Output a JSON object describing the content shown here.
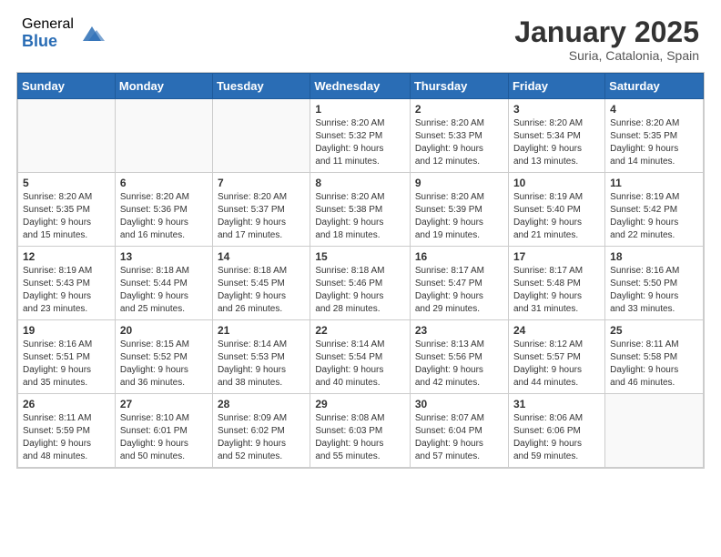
{
  "logo": {
    "general": "General",
    "blue": "Blue"
  },
  "title": "January 2025",
  "location": "Suria, Catalonia, Spain",
  "days_of_week": [
    "Sunday",
    "Monday",
    "Tuesday",
    "Wednesday",
    "Thursday",
    "Friday",
    "Saturday"
  ],
  "weeks": [
    [
      {
        "day": "",
        "info": ""
      },
      {
        "day": "",
        "info": ""
      },
      {
        "day": "",
        "info": ""
      },
      {
        "day": "1",
        "info": "Sunrise: 8:20 AM\nSunset: 5:32 PM\nDaylight: 9 hours\nand 11 minutes."
      },
      {
        "day": "2",
        "info": "Sunrise: 8:20 AM\nSunset: 5:33 PM\nDaylight: 9 hours\nand 12 minutes."
      },
      {
        "day": "3",
        "info": "Sunrise: 8:20 AM\nSunset: 5:34 PM\nDaylight: 9 hours\nand 13 minutes."
      },
      {
        "day": "4",
        "info": "Sunrise: 8:20 AM\nSunset: 5:35 PM\nDaylight: 9 hours\nand 14 minutes."
      }
    ],
    [
      {
        "day": "5",
        "info": "Sunrise: 8:20 AM\nSunset: 5:35 PM\nDaylight: 9 hours\nand 15 minutes."
      },
      {
        "day": "6",
        "info": "Sunrise: 8:20 AM\nSunset: 5:36 PM\nDaylight: 9 hours\nand 16 minutes."
      },
      {
        "day": "7",
        "info": "Sunrise: 8:20 AM\nSunset: 5:37 PM\nDaylight: 9 hours\nand 17 minutes."
      },
      {
        "day": "8",
        "info": "Sunrise: 8:20 AM\nSunset: 5:38 PM\nDaylight: 9 hours\nand 18 minutes."
      },
      {
        "day": "9",
        "info": "Sunrise: 8:20 AM\nSunset: 5:39 PM\nDaylight: 9 hours\nand 19 minutes."
      },
      {
        "day": "10",
        "info": "Sunrise: 8:19 AM\nSunset: 5:40 PM\nDaylight: 9 hours\nand 21 minutes."
      },
      {
        "day": "11",
        "info": "Sunrise: 8:19 AM\nSunset: 5:42 PM\nDaylight: 9 hours\nand 22 minutes."
      }
    ],
    [
      {
        "day": "12",
        "info": "Sunrise: 8:19 AM\nSunset: 5:43 PM\nDaylight: 9 hours\nand 23 minutes."
      },
      {
        "day": "13",
        "info": "Sunrise: 8:18 AM\nSunset: 5:44 PM\nDaylight: 9 hours\nand 25 minutes."
      },
      {
        "day": "14",
        "info": "Sunrise: 8:18 AM\nSunset: 5:45 PM\nDaylight: 9 hours\nand 26 minutes."
      },
      {
        "day": "15",
        "info": "Sunrise: 8:18 AM\nSunset: 5:46 PM\nDaylight: 9 hours\nand 28 minutes."
      },
      {
        "day": "16",
        "info": "Sunrise: 8:17 AM\nSunset: 5:47 PM\nDaylight: 9 hours\nand 29 minutes."
      },
      {
        "day": "17",
        "info": "Sunrise: 8:17 AM\nSunset: 5:48 PM\nDaylight: 9 hours\nand 31 minutes."
      },
      {
        "day": "18",
        "info": "Sunrise: 8:16 AM\nSunset: 5:50 PM\nDaylight: 9 hours\nand 33 minutes."
      }
    ],
    [
      {
        "day": "19",
        "info": "Sunrise: 8:16 AM\nSunset: 5:51 PM\nDaylight: 9 hours\nand 35 minutes."
      },
      {
        "day": "20",
        "info": "Sunrise: 8:15 AM\nSunset: 5:52 PM\nDaylight: 9 hours\nand 36 minutes."
      },
      {
        "day": "21",
        "info": "Sunrise: 8:14 AM\nSunset: 5:53 PM\nDaylight: 9 hours\nand 38 minutes."
      },
      {
        "day": "22",
        "info": "Sunrise: 8:14 AM\nSunset: 5:54 PM\nDaylight: 9 hours\nand 40 minutes."
      },
      {
        "day": "23",
        "info": "Sunrise: 8:13 AM\nSunset: 5:56 PM\nDaylight: 9 hours\nand 42 minutes."
      },
      {
        "day": "24",
        "info": "Sunrise: 8:12 AM\nSunset: 5:57 PM\nDaylight: 9 hours\nand 44 minutes."
      },
      {
        "day": "25",
        "info": "Sunrise: 8:11 AM\nSunset: 5:58 PM\nDaylight: 9 hours\nand 46 minutes."
      }
    ],
    [
      {
        "day": "26",
        "info": "Sunrise: 8:11 AM\nSunset: 5:59 PM\nDaylight: 9 hours\nand 48 minutes."
      },
      {
        "day": "27",
        "info": "Sunrise: 8:10 AM\nSunset: 6:01 PM\nDaylight: 9 hours\nand 50 minutes."
      },
      {
        "day": "28",
        "info": "Sunrise: 8:09 AM\nSunset: 6:02 PM\nDaylight: 9 hours\nand 52 minutes."
      },
      {
        "day": "29",
        "info": "Sunrise: 8:08 AM\nSunset: 6:03 PM\nDaylight: 9 hours\nand 55 minutes."
      },
      {
        "day": "30",
        "info": "Sunrise: 8:07 AM\nSunset: 6:04 PM\nDaylight: 9 hours\nand 57 minutes."
      },
      {
        "day": "31",
        "info": "Sunrise: 8:06 AM\nSunset: 6:06 PM\nDaylight: 9 hours\nand 59 minutes."
      },
      {
        "day": "",
        "info": ""
      }
    ]
  ]
}
